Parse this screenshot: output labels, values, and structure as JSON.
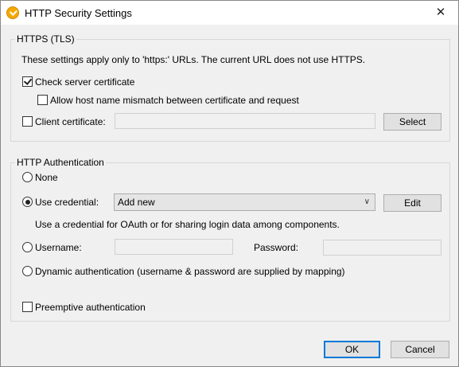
{
  "window": {
    "title": "HTTP Security Settings",
    "close_glyph": "✕",
    "app_icon": "altova-icon"
  },
  "https_group": {
    "title": "HTTPS (TLS)",
    "info": "These settings apply only to 'https:' URLs. The current URL does not use HTTPS.",
    "check_server_cert": {
      "label": "Check server certificate",
      "checked": true
    },
    "allow_mismatch": {
      "label": "Allow host name mismatch between certificate and request",
      "checked": false
    },
    "client_cert": {
      "label": "Client certificate:",
      "checked": false,
      "value": ""
    },
    "select_button": "Select"
  },
  "auth_group": {
    "title": "HTTP Authentication",
    "none_label": "None",
    "use_credential_label": "Use credential:",
    "credential_selected": "Add new",
    "edit_button": "Edit",
    "credential_hint": "Use a credential for OAuth or for sharing login data among components.",
    "username_label": "Username:",
    "username_value": "",
    "password_label": "Password:",
    "password_value": "",
    "dynamic_label": "Dynamic authentication (username & password are supplied by mapping)",
    "selected_option": "use_credential",
    "preemptive": {
      "label": "Preemptive authentication",
      "checked": false
    }
  },
  "footer": {
    "ok_label": "OK",
    "cancel_label": "Cancel"
  }
}
